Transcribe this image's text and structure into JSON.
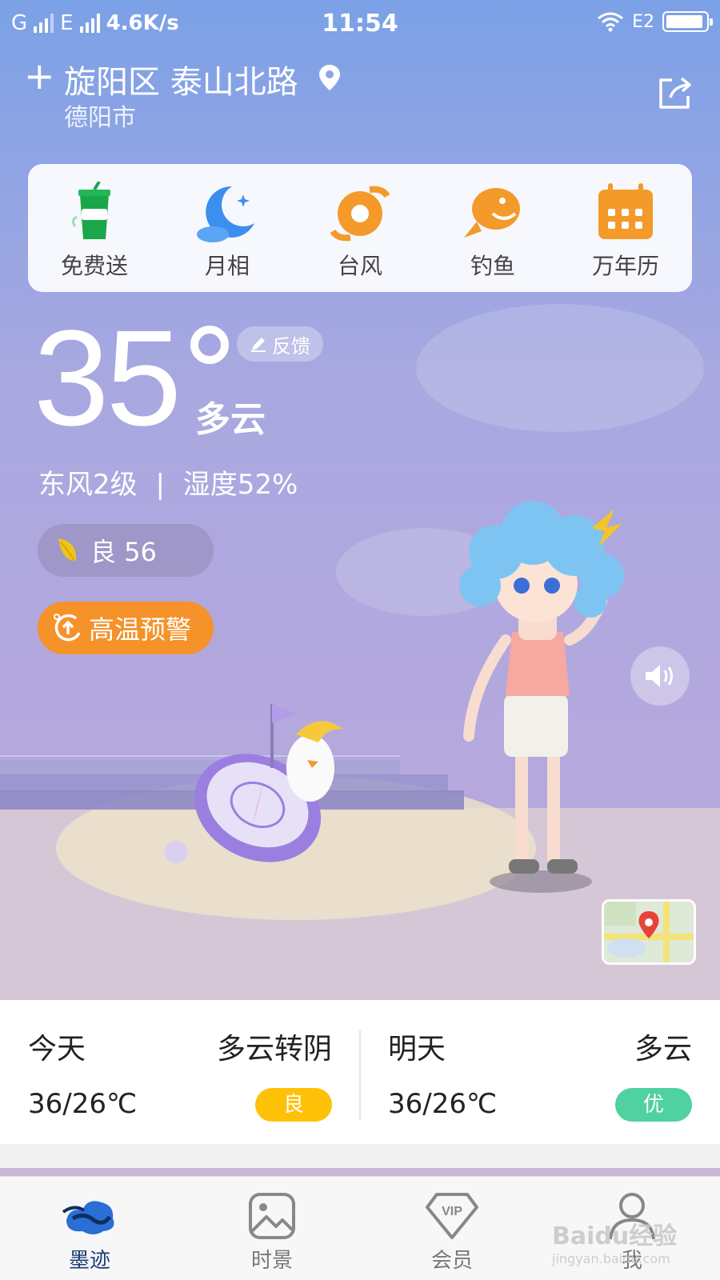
{
  "status_bar": {
    "carrier1": "G",
    "carrier2": "E",
    "speed": "4.6K/s",
    "time": "11:54",
    "sim_label": "E2"
  },
  "header": {
    "title": "旋阳区 泰山北路",
    "city": "德阳市"
  },
  "quick_actions": [
    {
      "label": "免费送",
      "icon": "cup-gift-icon"
    },
    {
      "label": "月相",
      "icon": "moon-icon"
    },
    {
      "label": "台风",
      "icon": "typhoon-icon"
    },
    {
      "label": "钓鱼",
      "icon": "fish-icon"
    },
    {
      "label": "万年历",
      "icon": "calendar-icon"
    }
  ],
  "current": {
    "temperature": "35",
    "condition": "多云",
    "feedback": "反馈",
    "wind": "东风2级",
    "separator": "|",
    "humidity": "湿度52%",
    "aqi": "良 56",
    "warning": "高温预警"
  },
  "forecast": {
    "today": {
      "day": "今天",
      "weather": "多云转阴",
      "temp": "36/26℃",
      "quality": "良",
      "quality_color": "#ffc107"
    },
    "tomorrow": {
      "day": "明天",
      "weather": "多云",
      "temp": "36/26℃",
      "quality": "优",
      "quality_color": "#4fd1a0"
    }
  },
  "nav": [
    {
      "label": "墨迹",
      "icon": "moji-cloud-icon",
      "active": true
    },
    {
      "label": "时景",
      "icon": "image-icon",
      "active": false
    },
    {
      "label": "会员",
      "icon": "vip-icon",
      "active": false
    },
    {
      "label": "我",
      "icon": "person-icon",
      "active": false
    }
  ],
  "watermark": {
    "text": "Baidu经验",
    "sub": "jingyan.baidu.com"
  },
  "colors": {
    "accent_orange": "#f5922a",
    "nav_active": "#1b3c75"
  }
}
